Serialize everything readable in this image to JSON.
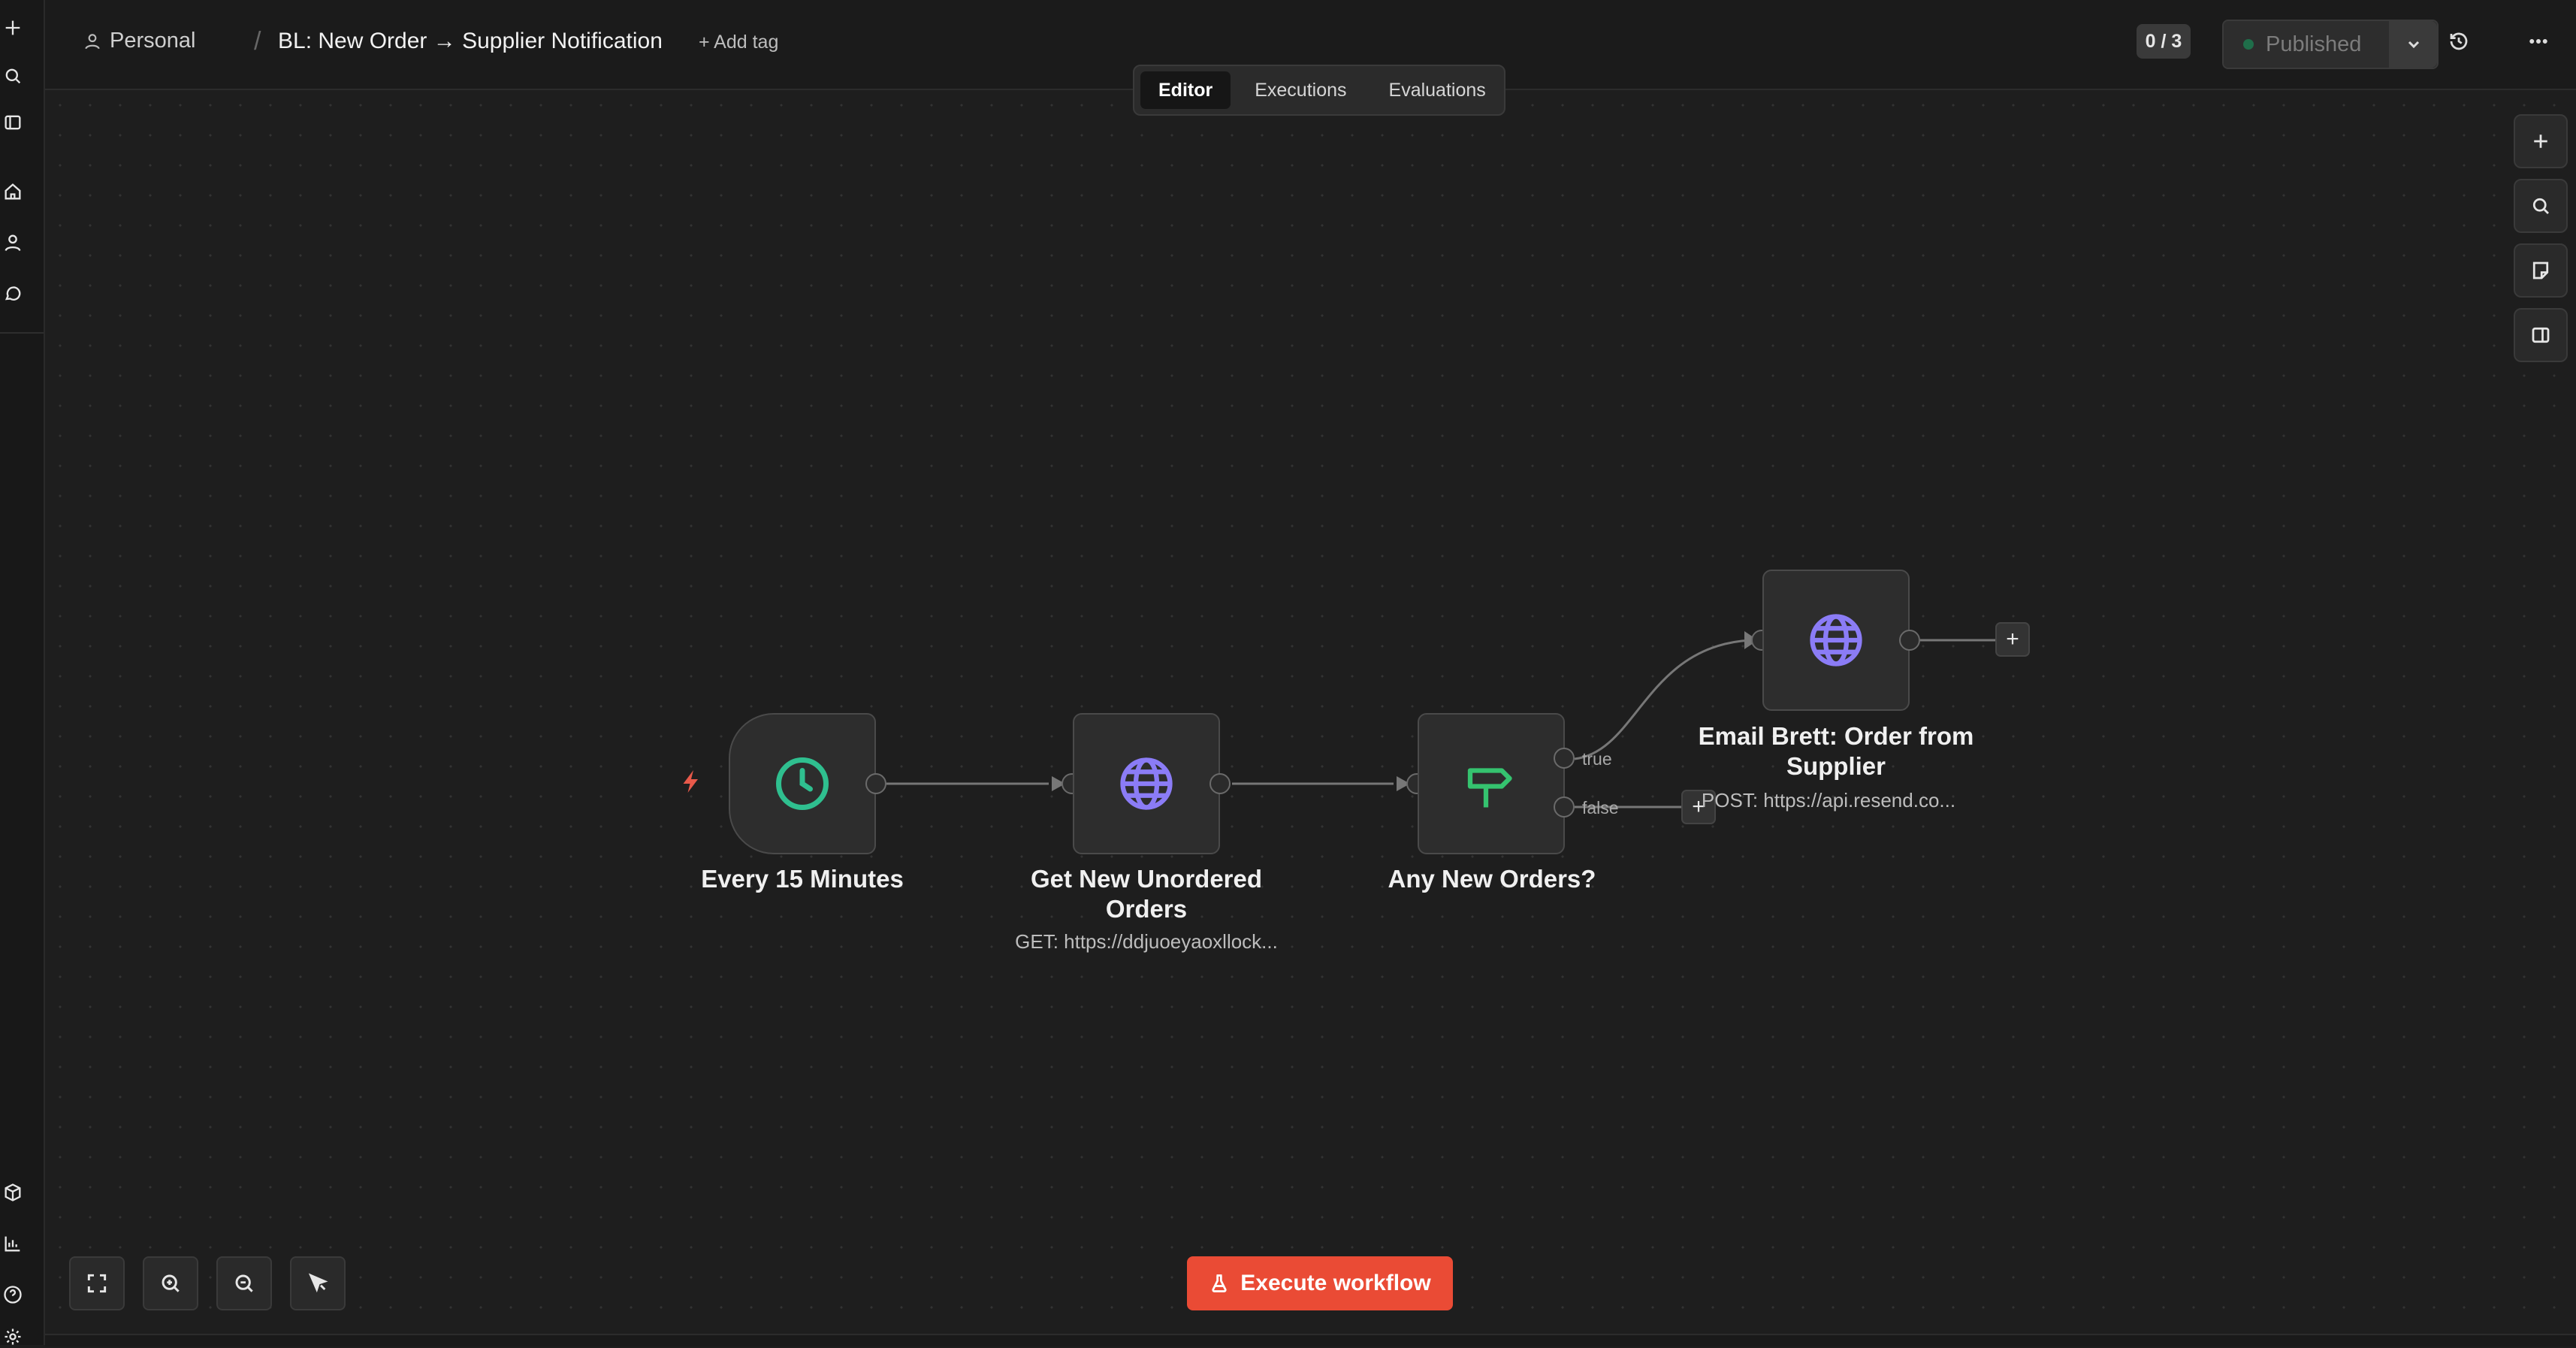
{
  "header": {
    "project": "Personal",
    "separator": "/",
    "workflow_title": "BL: New Order → Supplier Notification",
    "add_tag": "+ Add tag",
    "counter": "0 / 3",
    "publish_status": "Published"
  },
  "tabs": [
    {
      "label": "Editor",
      "active": true
    },
    {
      "label": "Executions",
      "active": false
    },
    {
      "label": "Evaluations",
      "active": false
    }
  ],
  "nodes": {
    "trigger": {
      "label": "Every 15 Minutes",
      "icon": "clock-icon",
      "color": "#2fbf8f"
    },
    "get_orders": {
      "label": "Get New Unordered Orders",
      "subtitle": "GET: https://ddjuoeyaoxllock...",
      "icon": "globe-icon",
      "color": "#8b7cf6"
    },
    "if_node": {
      "label": "Any New Orders?",
      "icon": "signpost-icon",
      "color": "#35c36f"
    },
    "email": {
      "label": "Email Brett: Order from Supplier",
      "subtitle": "POST: https://api.resend.co...",
      "icon": "globe-icon",
      "color": "#8b7cf6"
    }
  },
  "ports": {
    "true_label": "true",
    "false_label": "false"
  },
  "execute_button": {
    "label": "Execute workflow",
    "color": "#ea4b35"
  },
  "sidebar_icons": [
    "plus-icon",
    "search-icon",
    "panel-icon",
    "home-icon",
    "user-icon",
    "chat-icon",
    "box-icon",
    "chart-icon",
    "help-icon",
    "settings-icon"
  ],
  "canvas_tools": [
    "zoom-to-fit-icon",
    "zoom-in-icon",
    "zoom-out-icon",
    "cursor-icon"
  ],
  "right_tools": [
    "add-node-icon",
    "search-nodes-icon",
    "sticky-note-icon",
    "side-panel-icon"
  ]
}
